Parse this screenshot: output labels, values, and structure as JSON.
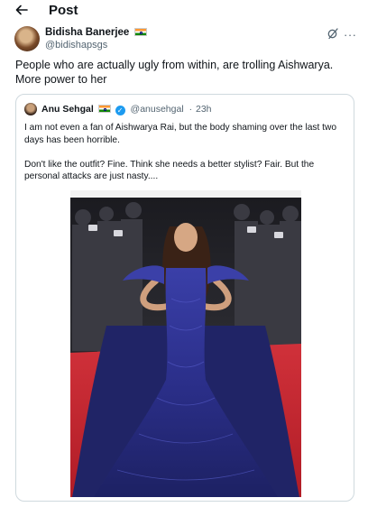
{
  "header": {
    "back_icon": "arrow-left-icon",
    "title": "Post"
  },
  "tweet": {
    "author_name": "Bidisha Banerjee",
    "author_flag": "india-flag-icon",
    "author_handle": "@bidishapsgs",
    "text": "People who are actually ugly from within, are trolling Aishwarya. More power to her",
    "action_icons": [
      "grok-icon",
      "more-icon"
    ],
    "more_glyph": "···"
  },
  "quoted_tweet": {
    "author_name": "Anu Sehgal",
    "author_flag": "india-flag-icon",
    "verified": true,
    "verified_glyph": "✓",
    "author_handle": "@anusehgal",
    "time": "23h",
    "paragraphs": [
      "I am not even a fan of Aishwarya Rai, but the body shaming over the last two days has been horrible.",
      "Don't like the outfit? Fine. Think she needs a better stylist? Fair. But the personal attacks are just nasty...."
    ]
  },
  "colors": {
    "text": "#0f1419",
    "muted": "#536471",
    "border": "#cfd9de",
    "accent": "#1d9bf0",
    "carpet": "#c4222a",
    "gown": "#2b2f8a"
  }
}
